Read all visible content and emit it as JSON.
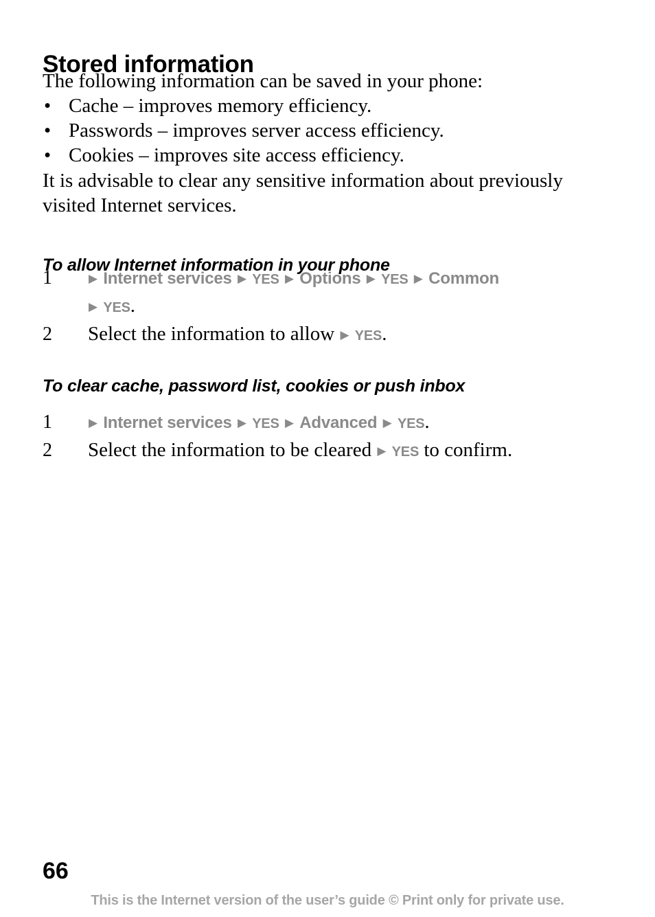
{
  "document": {
    "title": "Stored information",
    "intro": "The following information can be saved in your phone:",
    "bullets": [
      {
        "marker": "•",
        "text": "Cache – improves memory efficiency."
      },
      {
        "marker": "•",
        "text": "Passwords – improves server access efficiency."
      },
      {
        "marker": "•",
        "text": "Cookies – improves site access efficiency."
      }
    ],
    "advisory": "It is advisable to clear any sensitive information about previously visited Internet services.",
    "sections": [
      {
        "heading": "To allow Internet information in your phone",
        "steps": [
          {
            "number": "1",
            "line1": {
              "arrow1": "▶",
              "menu1": "Internet services",
              "arrow2": "▶",
              "key1": "YES",
              "arrow3": "▶",
              "menu2": "Options",
              "arrow4": "▶",
              "key2": "YES",
              "arrow5": "▶",
              "menu3": "Common"
            },
            "line2": {
              "arrow": "▶",
              "key": "YES",
              "period": "."
            }
          },
          {
            "number": "2",
            "text_before": "Select the information to allow ",
            "arrow": "▶",
            "key": "YES",
            "period": "."
          }
        ]
      },
      {
        "heading": "To clear cache, password list, cookies or push inbox",
        "steps": [
          {
            "number": "1",
            "arrow1": "▶",
            "menu1": "Internet services",
            "arrow2": "▶",
            "key1": "YES",
            "arrow3": "▶",
            "menu2": "Advanced",
            "arrow4": "▶",
            "key2": "YES",
            "period": "."
          },
          {
            "number": "2",
            "text_before": "Select the information to be cleared ",
            "arrow": "▶",
            "key": "YES",
            "text_after": " to confirm."
          }
        ]
      }
    ]
  },
  "footer": {
    "page_number": "66",
    "note": "This is the Internet version of the user’s guide © Print only for private use."
  },
  "colors": {
    "text": "#000000",
    "nav_gray": "#8a8a8a",
    "footer_gray": "#a6a6a6",
    "background": "#ffffff"
  }
}
